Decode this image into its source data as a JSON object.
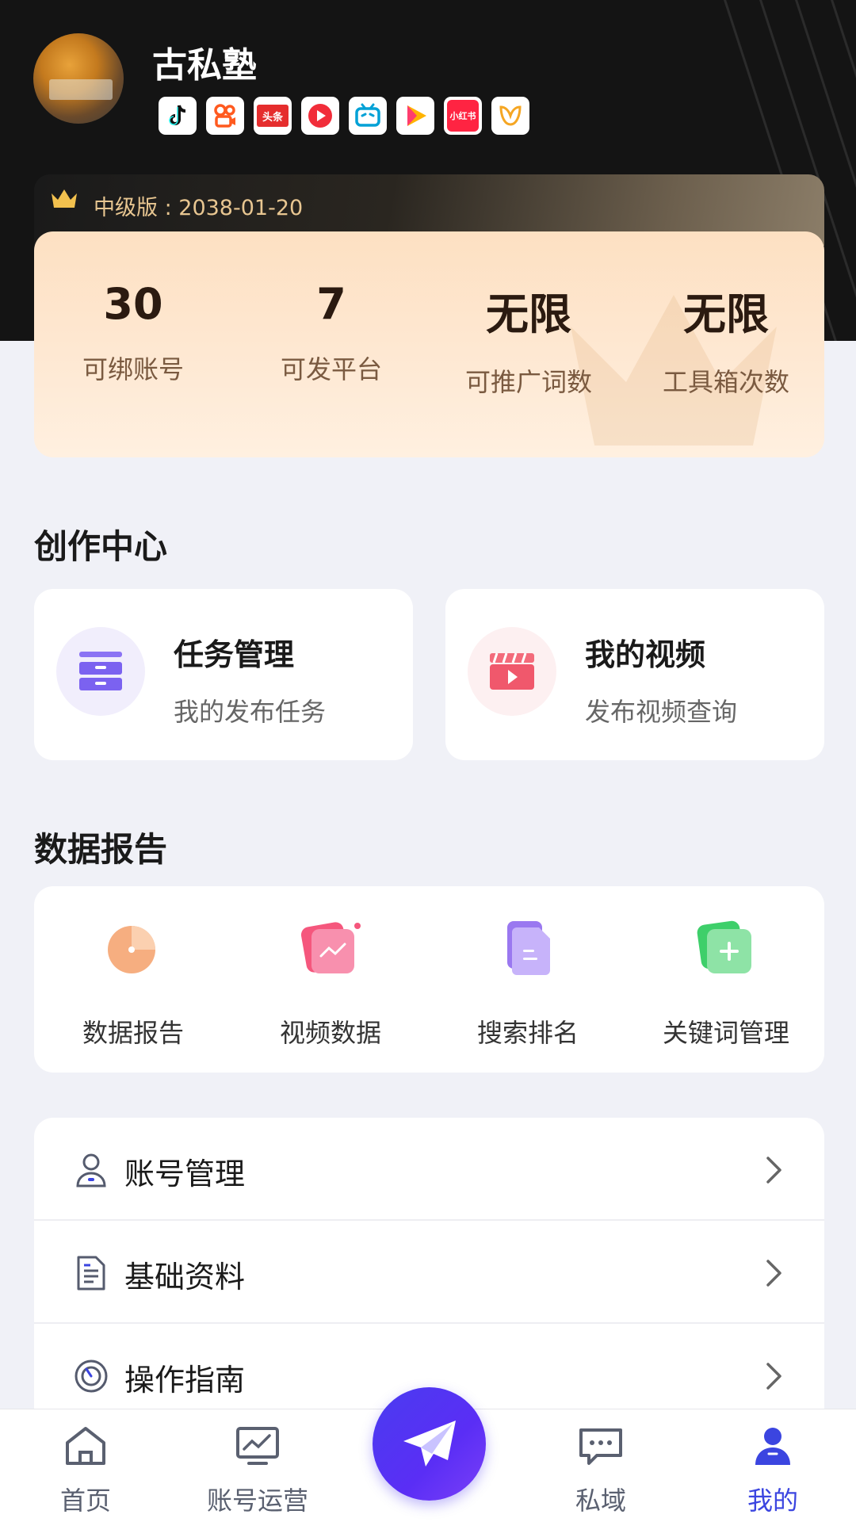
{
  "profile": {
    "name": "古私塾",
    "platform_icons": [
      "douyin-icon",
      "kuaishou-icon",
      "toutiao-icon",
      "xigua-icon",
      "bilibili-icon",
      "video-channel-icon",
      "xiaohongshu-icon",
      "weibo-icon"
    ],
    "toutiao_text": "头条",
    "xiaohongshu_text": "小红书"
  },
  "membership": {
    "label": "中级版 : 2038-01-20",
    "stats": [
      {
        "value": "30",
        "label": "可绑账号"
      },
      {
        "value": "7",
        "label": "可发平台"
      },
      {
        "value": "无限",
        "label": "可推广词数"
      },
      {
        "value": "无限",
        "label": "工具箱次数"
      }
    ]
  },
  "creation_center": {
    "title": "创作中心",
    "cards": [
      {
        "title": "任务管理",
        "subtitle": "我的发布任务",
        "icon": "drawer-icon"
      },
      {
        "title": "我的视频",
        "subtitle": "发布视频查询",
        "icon": "video-clapper-icon"
      }
    ]
  },
  "data_report": {
    "title": "数据报告",
    "items": [
      {
        "label": "数据报告",
        "icon": "pie-chart-icon"
      },
      {
        "label": "视频数据",
        "icon": "trend-card-icon"
      },
      {
        "label": "搜索排名",
        "icon": "document-icon"
      },
      {
        "label": "关键词管理",
        "icon": "add-card-icon"
      }
    ]
  },
  "menu": [
    {
      "label": "账号管理",
      "icon": "user-icon"
    },
    {
      "label": "基础资料",
      "icon": "file-icon"
    },
    {
      "label": "操作指南",
      "icon": "compass-icon"
    }
  ],
  "tabbar": {
    "items": [
      {
        "label": "首页",
        "icon": "home-icon"
      },
      {
        "label": "账号运营",
        "icon": "monitor-chart-icon"
      },
      {
        "label": "私域",
        "icon": "chat-icon"
      },
      {
        "label": "我的",
        "icon": "profile-icon"
      }
    ],
    "active": "我的",
    "fab_icon": "paper-plane-icon"
  },
  "colors": {
    "accent": "#3b45e0",
    "header_bg": "#141414",
    "vip_text": "#e8c691",
    "stats_bg": "#fde0c2"
  }
}
